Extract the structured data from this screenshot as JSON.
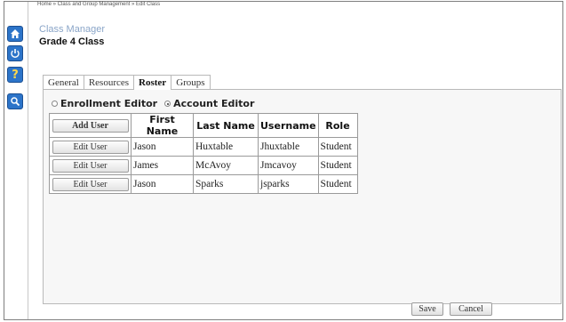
{
  "breadcrumb": "Home » Class and Group Management » Edit Class",
  "app_title": "Class Manager",
  "page_title": "Grade 4 Class",
  "left_rail": [
    {
      "icon": "home-icon",
      "glyph": "⌂"
    },
    {
      "icon": "power-icon",
      "glyph": "⏻"
    },
    {
      "icon": "help-icon",
      "glyph": "?"
    },
    {
      "icon": "magnifier-icon",
      "glyph": ""
    }
  ],
  "tabs": [
    {
      "label": "General",
      "active": false
    },
    {
      "label": "Resources",
      "active": false
    },
    {
      "label": "Roster",
      "active": true
    },
    {
      "label": "Groups",
      "active": false
    }
  ],
  "editor_mode": {
    "options": [
      "Enrollment Editor",
      "Account Editor"
    ],
    "selected": "Account Editor"
  },
  "roster": {
    "add_user_label": "Add User",
    "headers": [
      "First Name",
      "Last Name",
      "Username",
      "Role"
    ],
    "rows": [
      {
        "action": "Edit User",
        "first": "Jason",
        "last": "Huxtable",
        "username": "Jhuxtable",
        "role": "Student"
      },
      {
        "action": "Edit User",
        "first": "James",
        "last": "McAvoy",
        "username": "Jmcavoy",
        "role": "Student"
      },
      {
        "action": "Edit User",
        "first": "Jason",
        "last": "Sparks",
        "username": "jsparks",
        "role": "Student"
      }
    ]
  },
  "footer": {
    "save_label": "Save",
    "cancel_label": "Cancel"
  },
  "colors": {
    "rail_icon_blue": "#2c74c9",
    "app_title": "#8aa5c8"
  }
}
